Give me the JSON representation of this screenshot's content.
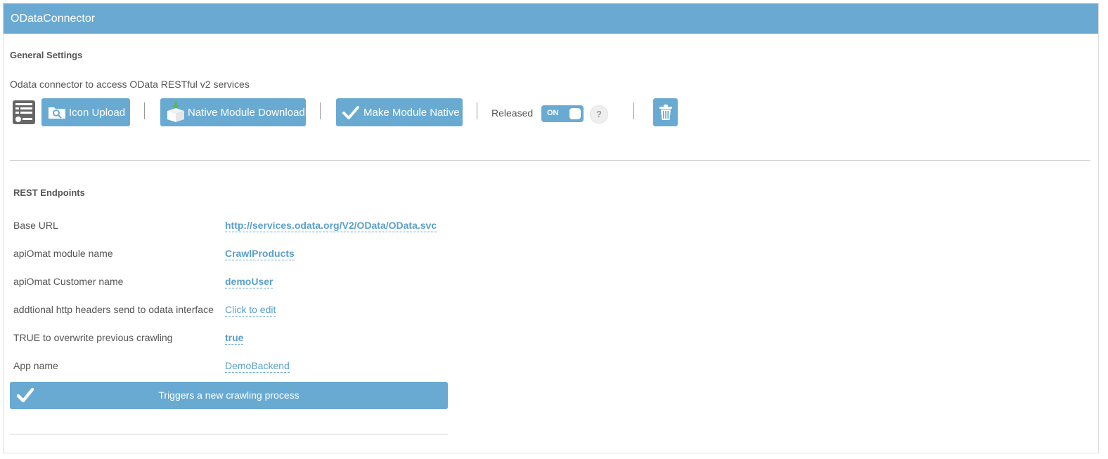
{
  "panel": {
    "title": "ODataConnector"
  },
  "general": {
    "title": "General Settings",
    "description": "Odata connector to access OData RESTful v2 services",
    "icon_upload_label": "Icon Upload",
    "native_download_label": "Native Module Download",
    "make_native_label": "Make Module Native",
    "released_label": "Released",
    "toggle_label": "ON",
    "help_label": "?"
  },
  "rest": {
    "title": "REST Endpoints",
    "rows": [
      {
        "label": "Base URL",
        "value": "http://services.odata.org/V2/OData/OData.svc"
      },
      {
        "label": "apiOmat module name",
        "value": "CrawlProducts"
      },
      {
        "label": "apiOmat Customer name",
        "value": "demoUser"
      },
      {
        "label": "addtional http headers send to odata interface",
        "value": "Click to edit"
      },
      {
        "label": "TRUE to overwrite previous crawling",
        "value": "true"
      },
      {
        "label": "App name",
        "value": "DemoBackend"
      }
    ],
    "trigger_label": "Triggers a new crawling process"
  },
  "colors": {
    "accent": "#68aad2",
    "header": "#6aaad2",
    "link": "#5a9fcc"
  }
}
